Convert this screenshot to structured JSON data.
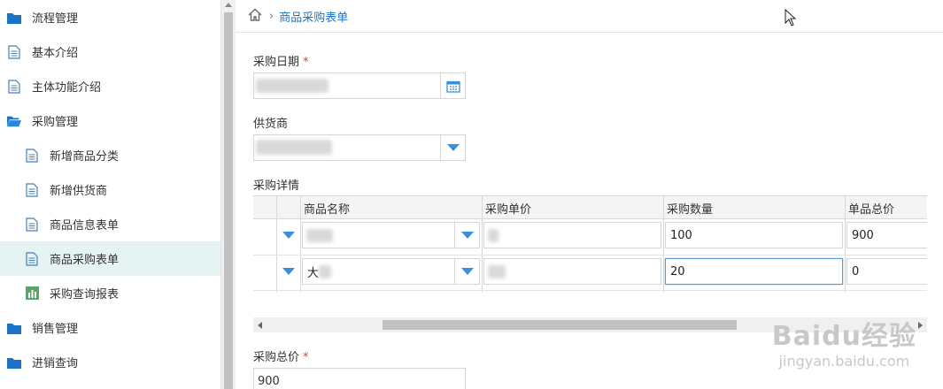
{
  "sidebar": {
    "items": [
      {
        "label": "流程管理",
        "icon": "folder-icon",
        "level": "top"
      },
      {
        "label": "基本介绍",
        "icon": "document-icon",
        "level": "top"
      },
      {
        "label": "主体功能介绍",
        "icon": "document-icon",
        "level": "top"
      },
      {
        "label": "采购管理",
        "icon": "folder-open-icon",
        "level": "top"
      },
      {
        "label": "新增商品分类",
        "icon": "document-icon",
        "level": "sub"
      },
      {
        "label": "新增供货商",
        "icon": "document-icon",
        "level": "sub"
      },
      {
        "label": "商品信息表单",
        "icon": "document-icon",
        "level": "sub"
      },
      {
        "label": "商品采购表单",
        "icon": "document-icon",
        "level": "sub",
        "active": true
      },
      {
        "label": "采购查询报表",
        "icon": "bar-chart-icon",
        "level": "sub"
      },
      {
        "label": "销售管理",
        "icon": "folder-icon",
        "level": "top"
      },
      {
        "label": "进销查询",
        "icon": "folder-icon",
        "level": "top"
      }
    ]
  },
  "breadcrumb": {
    "current": "商品采购表单"
  },
  "form": {
    "purchase_date_label": "采购日期",
    "supplier_label": "供货商",
    "details_label": "采购详情",
    "total_label": "采购总价",
    "total_value": "900",
    "required_mark": "*"
  },
  "grid": {
    "columns": [
      "商品名称",
      "采购单价",
      "采购数量",
      "单品总价"
    ],
    "rows": [
      {
        "name_prefix": "",
        "quantity": "100",
        "subtotal": "900"
      },
      {
        "name_prefix": "大",
        "quantity": "20",
        "subtotal": "0"
      }
    ]
  },
  "watermark": {
    "brand": "Baidu经验",
    "url": "jingyan.baidu.com"
  },
  "colors": {
    "accent": "#3a8fdc",
    "active_bg": "#e6f3f3",
    "folder": "#1a73c7",
    "chart_icon": "#5aa469",
    "required": "#e53935"
  }
}
